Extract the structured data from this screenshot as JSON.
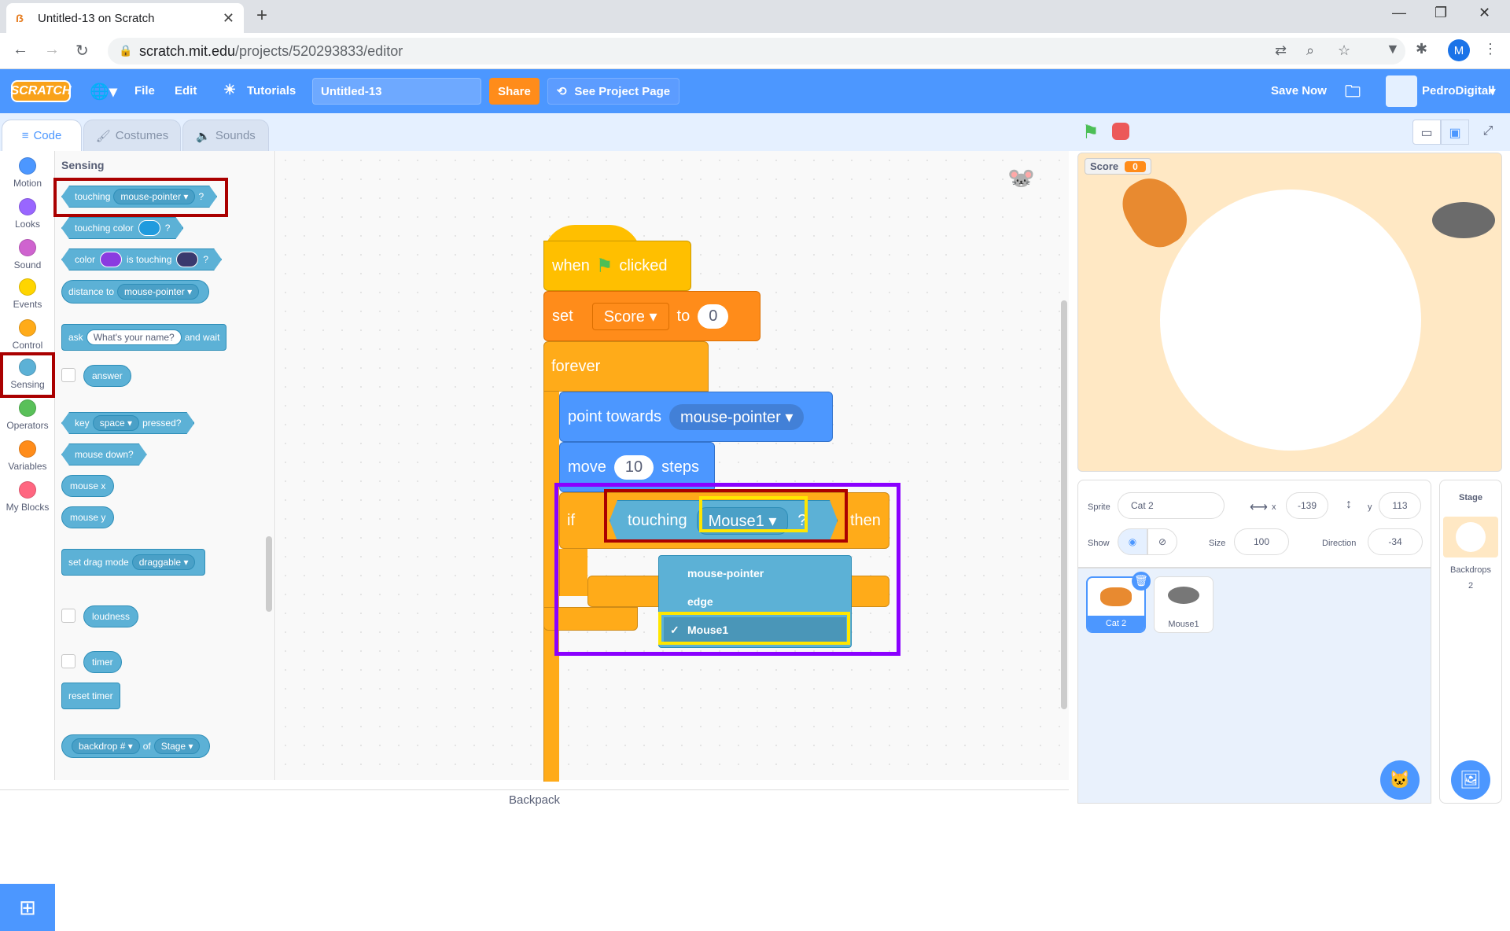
{
  "browser": {
    "tab_title": "Untitled-13 on Scratch",
    "url_host": "scratch.mit.edu",
    "url_path": "/projects/520293833/editor",
    "profile_initial": "M"
  },
  "menubar": {
    "logo": "SCRATCH",
    "file": "File",
    "edit": "Edit",
    "tutorials": "Tutorials",
    "project_title": "Untitled-13",
    "share": "Share",
    "see_project": "See Project Page",
    "save_now": "Save Now",
    "username": "PedroDigitall"
  },
  "editor_tabs": [
    "Code",
    "Costumes",
    "Sounds"
  ],
  "categories": [
    {
      "label": "Motion",
      "color": "#4c97ff"
    },
    {
      "label": "Looks",
      "color": "#9966ff"
    },
    {
      "label": "Sound",
      "color": "#cf63cf"
    },
    {
      "label": "Events",
      "color": "#ffd500"
    },
    {
      "label": "Control",
      "color": "#ffab19"
    },
    {
      "label": "Sensing",
      "color": "#5cb1d6"
    },
    {
      "label": "Operators",
      "color": "#59c059"
    },
    {
      "label": "Variables",
      "color": "#ff8c1a"
    },
    {
      "label": "My Blocks",
      "color": "#ff6680"
    }
  ],
  "palette": {
    "heading": "Sensing",
    "touching": "touching",
    "touching_target": "mouse-pointer",
    "q": "?",
    "touching_color": "touching color",
    "color": "color",
    "is_touching": "is touching",
    "distance_to": "distance to",
    "distance_target": "mouse-pointer",
    "ask": "ask",
    "ask_default": "What's your name?",
    "and_wait": "and wait",
    "answer": "answer",
    "key": "key",
    "key_value": "space",
    "pressed": "pressed?",
    "mouse_down": "mouse down?",
    "mouse_x": "mouse x",
    "mouse_y": "mouse y",
    "set_drag_mode": "set drag mode",
    "drag_value": "draggable",
    "loudness": "loudness",
    "timer": "timer",
    "reset_timer": "reset timer",
    "backdrop_num": "backdrop #",
    "of": "of",
    "stage": "Stage"
  },
  "script": {
    "when": "when",
    "clicked": "clicked",
    "set": "set",
    "var": "Score",
    "to": "to",
    "set_value": "0",
    "forever": "forever",
    "point_towards": "point towards",
    "point_target": "mouse-pointer",
    "move": "move",
    "move_value": "10",
    "steps": "steps",
    "if": "if",
    "touching": "touching",
    "touching_target": "Mouse1",
    "q": "?",
    "then": "then"
  },
  "dropdown_options": [
    "mouse-pointer",
    "edge",
    "Mouse1"
  ],
  "dropdown_selected": "Mouse1",
  "dropdown_check": "✓",
  "stage": {
    "monitor_label": "Score",
    "monitor_value": "0"
  },
  "sprite_info": {
    "sprite_label": "Sprite",
    "sprite_name": "Cat 2",
    "x_label": "x",
    "x_value": "-139",
    "y_label": "y",
    "y_value": "113",
    "show_label": "Show",
    "size_label": "Size",
    "size_value": "100",
    "direction_label": "Direction",
    "direction_value": "-34"
  },
  "sprites": [
    "Cat 2",
    "Mouse1"
  ],
  "stage_panel": {
    "title": "Stage",
    "backdrops_label": "Backdrops",
    "backdrops_count": "2"
  },
  "backpack": "Backpack"
}
